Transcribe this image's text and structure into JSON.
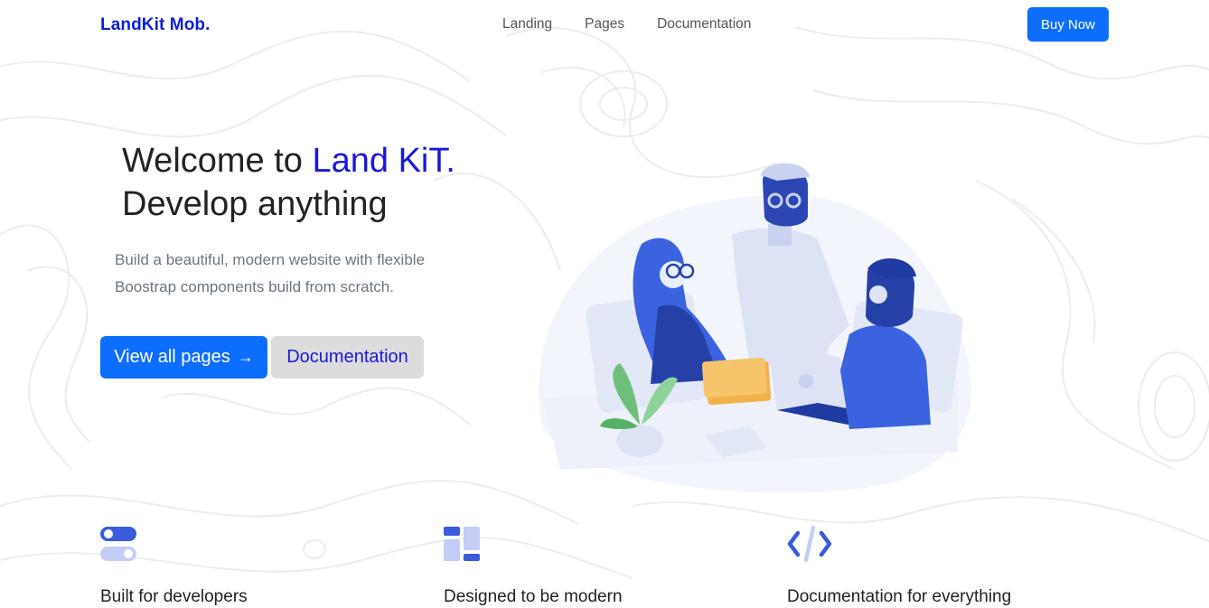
{
  "navbar": {
    "brand": "LandKit Mob.",
    "links": [
      "Landing",
      "Pages",
      "Documentation"
    ],
    "cta": "Buy Now"
  },
  "hero": {
    "title_prefix": "Welcome to ",
    "title_accent": "Land KiT.",
    "title_line2": "Develop anything",
    "subtitle_line1": "Build a beautiful, modern website with flexible",
    "subtitle_line2": "Boostrap components build from scratch.",
    "primary_button": "View all pages",
    "primary_button_icon": "arrow-right-icon",
    "secondary_button": "Documentation",
    "illustration": "team-meeting-illustration"
  },
  "features": [
    {
      "icon": "toggle-switches-icon",
      "title": "Built for developers"
    },
    {
      "icon": "layout-blocks-icon",
      "title": "Designed to be modern"
    },
    {
      "icon": "code-brackets-icon",
      "title": "Documentation for everything"
    }
  ],
  "colors": {
    "accent": "#1a18d8",
    "primary": "#0d6efd",
    "secondary_bg": "#dcdcdc",
    "icon_blue": "#3b5bdb",
    "icon_light": "#c3cdf5"
  }
}
